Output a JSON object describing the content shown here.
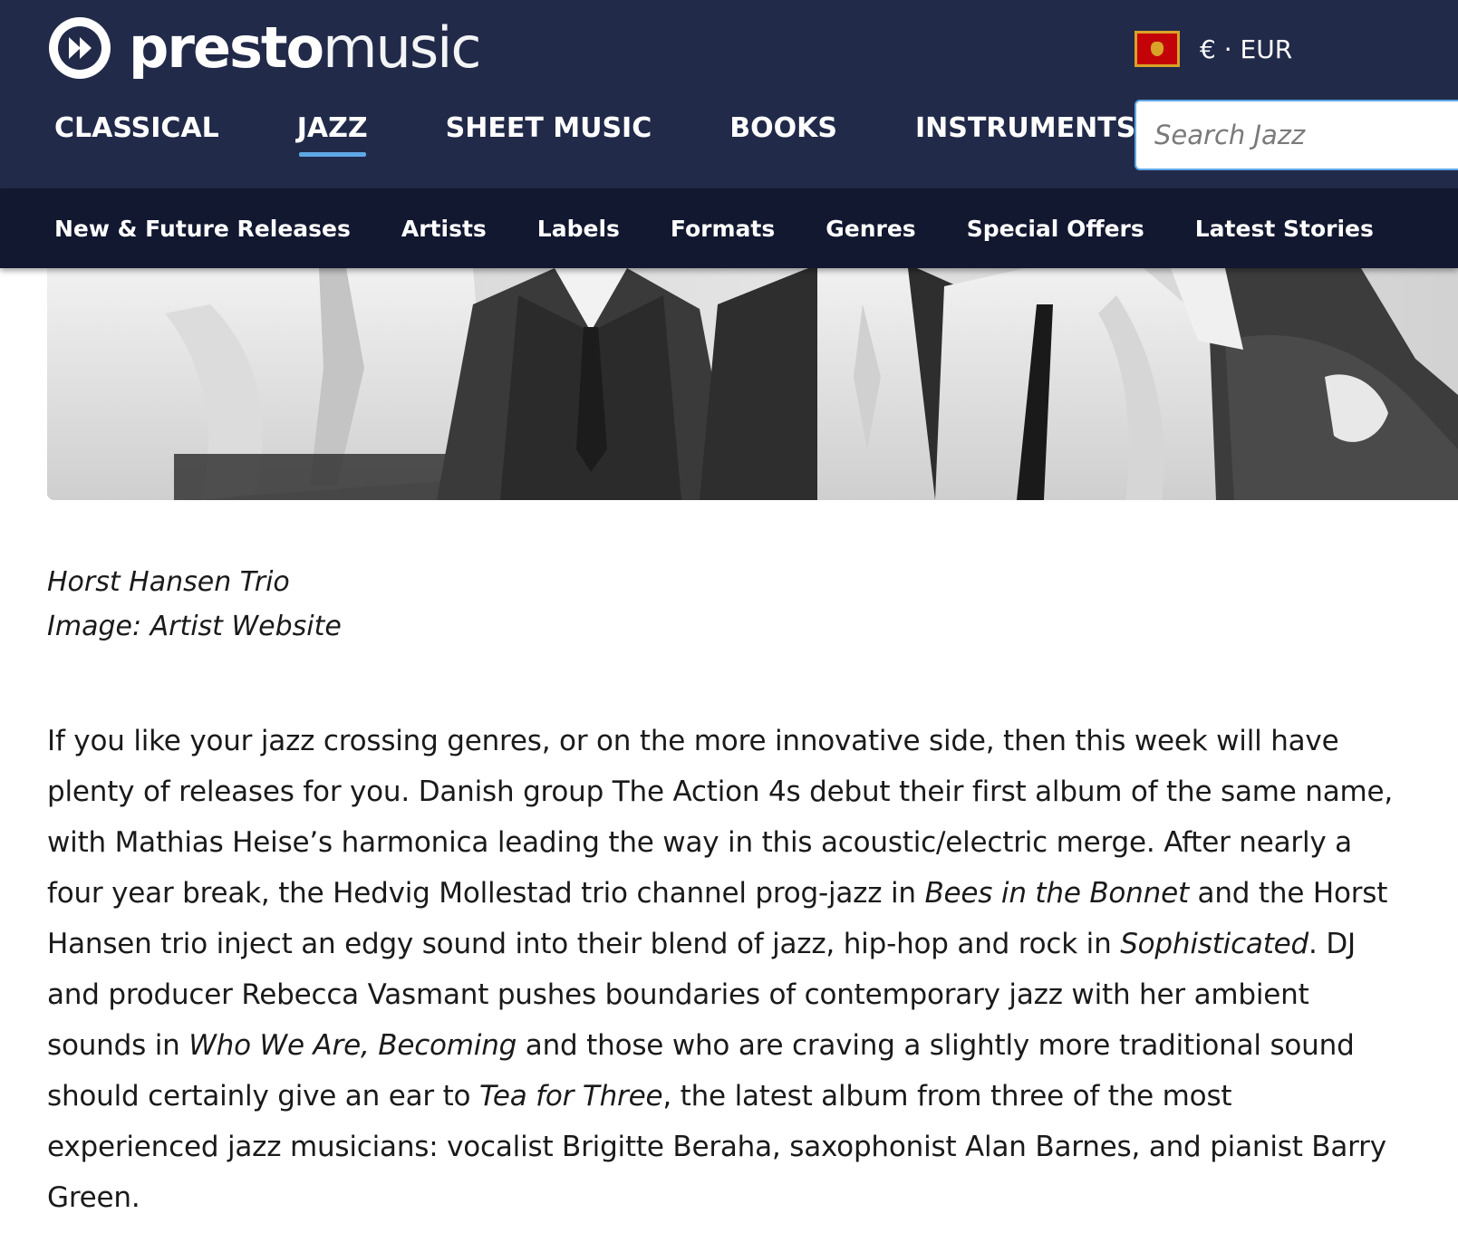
{
  "brand": {
    "name_bold": "presto",
    "name_light": "music"
  },
  "currency": {
    "label": "€ · EUR",
    "flag_colors": {
      "field": "#c40308",
      "border": "#d8a328"
    }
  },
  "main_nav": {
    "items": [
      {
        "label": "CLASSICAL",
        "active": false
      },
      {
        "label": "JAZZ",
        "active": true
      },
      {
        "label": "SHEET MUSIC",
        "active": false
      },
      {
        "label": "BOOKS",
        "active": false
      },
      {
        "label": "INSTRUMENTS",
        "active": false
      }
    ]
  },
  "search": {
    "placeholder": "Search Jazz",
    "value": ""
  },
  "sub_nav": {
    "items": [
      "New & Future Releases",
      "Artists",
      "Labels",
      "Formats",
      "Genres",
      "Special Offers",
      "Latest Stories"
    ]
  },
  "hero": {
    "caption_title": "Horst Hansen Trio",
    "caption_credit": "Image: Artist Website"
  },
  "article": {
    "p1_a": "If you like your jazz crossing genres, or on the more innovative side, then this week will have plenty of releases for you. Danish group The Action 4s debut their first album of the same name, with Mathias Heise’s harmonica leading the way in this acoustic/electric merge. After nearly a four year break, the Hedvig Mollestad trio channel prog-jazz in ",
    "p1_em1": "Bees in the Bonnet",
    "p1_b": " and the Horst Hansen trio inject an edgy sound into their blend of jazz, hip-hop and rock in ",
    "p1_em2": "Sophisticated",
    "p1_c": ". DJ and producer Rebecca Vasmant pushes boundaries of contemporary jazz with her ambient sounds in ",
    "p1_em3": "Who We Are, Becoming",
    "p1_d": " and those who are craving a slightly more traditional sound should certainly give an ear to ",
    "p1_em4": "Tea for Three",
    "p1_e": ", the latest album from three of the most experienced jazz musicians: vocalist Brigitte Beraha, saxophonist Alan Barnes, and pianist Barry Green."
  },
  "colors": {
    "header_bg": "#222a4a",
    "subnav_bg": "#121830",
    "accent": "#5fa8e6"
  }
}
